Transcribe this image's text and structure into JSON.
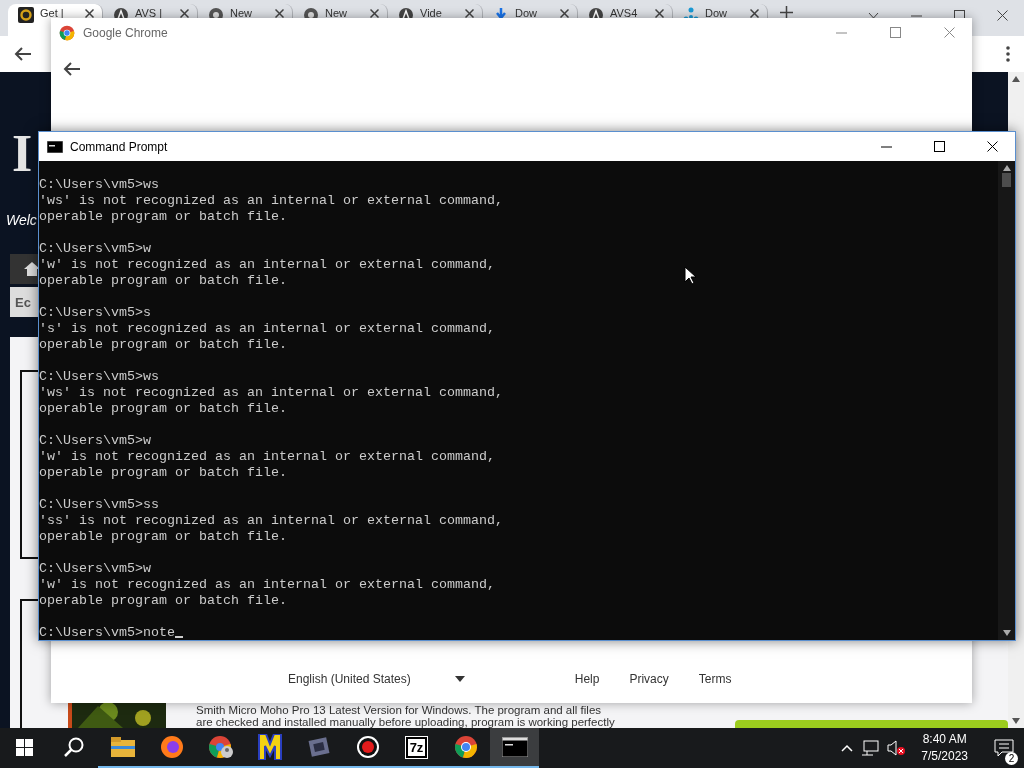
{
  "browser": {
    "tabs": [
      {
        "title": "Get |",
        "kind": "letter",
        "selected": true
      },
      {
        "title": "AVS |",
        "kind": "disc",
        "selected": false
      },
      {
        "title": "New",
        "kind": "chrome",
        "selected": false
      },
      {
        "title": "New",
        "kind": "chrome",
        "selected": false
      },
      {
        "title": "Vide",
        "kind": "disc",
        "selected": false
      },
      {
        "title": "Dow",
        "kind": "download",
        "selected": false
      },
      {
        "title": "AVS4",
        "kind": "disc",
        "selected": false
      },
      {
        "title": "Dow",
        "kind": "network",
        "selected": false
      }
    ],
    "page": {
      "logo": "I",
      "welcome": "Welc",
      "nav_button": "Ec",
      "body_lines": [
        "Smith Micro Moho Pro 13 Latest Version for Windows. The program and all files",
        "are checked and installed manually before uploading, program is working perfectly"
      ]
    }
  },
  "popup": {
    "title": "Google Chrome",
    "language": "English (United States)",
    "links": [
      "Help",
      "Privacy",
      "Terms"
    ]
  },
  "console": {
    "title": "Command Prompt",
    "entries": [
      {
        "command": "C:\\Users\\vm5>ws",
        "output": [
          "'ws' is not recognized as an internal or external command,",
          "operable program or batch file."
        ]
      },
      {
        "command": "C:\\Users\\vm5>w",
        "output": [
          "'w' is not recognized as an internal or external command,",
          "operable program or batch file."
        ]
      },
      {
        "command": "C:\\Users\\vm5>s",
        "output": [
          "'s' is not recognized as an internal or external command,",
          "operable program or batch file."
        ]
      },
      {
        "command": "C:\\Users\\vm5>ws",
        "output": [
          "'ws' is not recognized as an internal or external command,",
          "operable program or batch file."
        ]
      },
      {
        "command": "C:\\Users\\vm5>w",
        "output": [
          "'w' is not recognized as an internal or external command,",
          "operable program or batch file."
        ]
      },
      {
        "command": "C:\\Users\\vm5>ss",
        "output": [
          "'ss' is not recognized as an internal or external command,",
          "operable program or batch file."
        ]
      },
      {
        "command": "C:\\Users\\vm5>w",
        "output": [
          "'w' is not recognized as an internal or external command,",
          "operable program or batch file."
        ]
      }
    ],
    "prompt": "C:\\Users\\vm5>note"
  },
  "taskbar": {
    "apps": [
      {
        "kind": "explorer",
        "running": true,
        "active": false
      },
      {
        "kind": "firefox",
        "running": true,
        "active": false
      },
      {
        "kind": "chrome-profile",
        "running": true,
        "active": false
      },
      {
        "kind": "m",
        "running": true,
        "active": false
      },
      {
        "kind": "film",
        "running": true,
        "active": false
      },
      {
        "kind": "record",
        "running": true,
        "active": false
      },
      {
        "kind": "archive",
        "running": true,
        "active": false
      },
      {
        "kind": "chrome",
        "running": true,
        "active": false
      },
      {
        "kind": "console",
        "running": true,
        "active": true
      }
    ],
    "sevenzip_label": "7z",
    "time": "8:40 AM",
    "date": "7/5/2023",
    "notifications": "2"
  }
}
